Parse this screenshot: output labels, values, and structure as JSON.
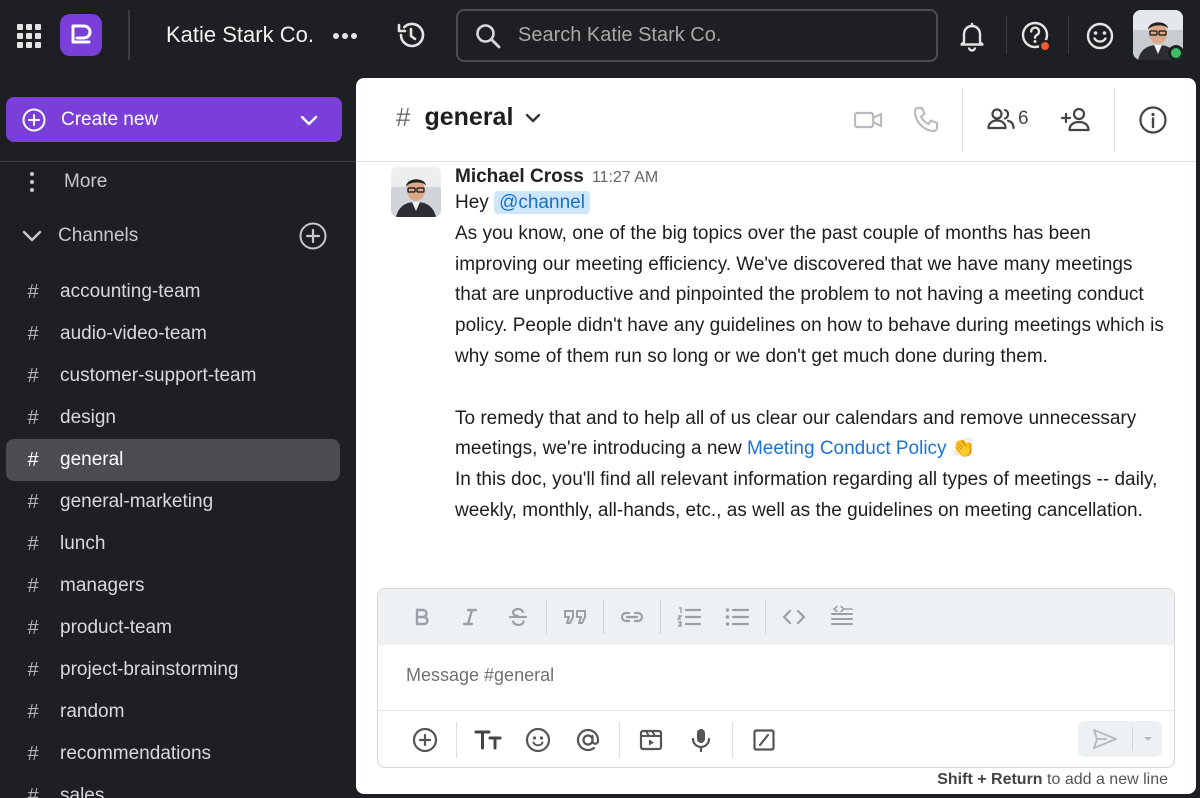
{
  "topbar": {
    "team_name": "Katie Stark Co.",
    "search_placeholder": "Search Katie Stark Co.",
    "icons": [
      "apps-grid-icon",
      "workspace-logo",
      "more-horizontal-icon",
      "history-icon",
      "search-icon",
      "bell-icon",
      "help-icon",
      "emoji-icon",
      "user-avatar"
    ],
    "colors": {
      "logo": "#7a3fd8",
      "help_badge": "#f1582b",
      "online_status": "#3dbd61"
    }
  },
  "sidebar": {
    "create_label": "Create new",
    "more_label": "More",
    "channels_header": "Channels",
    "channels": [
      {
        "name": "accounting-team",
        "active": false
      },
      {
        "name": "audio-video-team",
        "active": false
      },
      {
        "name": "customer-support-team",
        "active": false
      },
      {
        "name": "design",
        "active": false
      },
      {
        "name": "general",
        "active": true
      },
      {
        "name": "general-marketing",
        "active": false
      },
      {
        "name": "lunch",
        "active": false
      },
      {
        "name": "managers",
        "active": false
      },
      {
        "name": "product-team",
        "active": false
      },
      {
        "name": "project-brainstorming",
        "active": false
      },
      {
        "name": "random",
        "active": false
      },
      {
        "name": "recommendations",
        "active": false
      },
      {
        "name": "sales",
        "active": false
      }
    ]
  },
  "channel": {
    "hash": "#",
    "name": "general",
    "member_count": "6",
    "header_icons": [
      "video-call-icon",
      "phone-call-icon",
      "members-icon",
      "add-member-icon",
      "info-icon"
    ]
  },
  "message": {
    "author": "Michael Cross",
    "time": "11:27 AM",
    "greeting": "Hey",
    "mention": "@channel",
    "para1": "As you know, one of the big topics over the past couple of months has been improving our meeting efficiency. We've discovered that we have many meetings that are unproductive and pinpointed the problem to not having a meeting conduct policy. People didn't have any guidelines on how to behave during meetings which is why some of them run so long or we don't get much done during them.",
    "para2_prefix": "To remedy that and to help all of us clear our calendars and remove unnecessary meetings, we're introducing a new",
    "link_text": "Meeting Conduct Policy",
    "emoji": "👏",
    "para3": "In this doc, you'll find all relevant information regarding all types of meetings -- daily, weekly, monthly, all-hands, etc., as well as the guidelines on meeting cancellation."
  },
  "composer": {
    "placeholder": "Message #general",
    "format_icons": [
      "bold-icon",
      "italic-icon",
      "strikethrough-icon",
      "quote-icon",
      "link-icon",
      "numbered-list-icon",
      "bulleted-list-icon",
      "code-icon",
      "code-block-icon"
    ],
    "tool_icons": [
      "attach-plus-icon",
      "text-format-icon",
      "emoji-icon",
      "mention-icon",
      "gif-icon",
      "microphone-icon",
      "slash-command-icon",
      "send-icon"
    ],
    "hint_keys": "Shift + Return",
    "hint_text": " to add a new line"
  }
}
